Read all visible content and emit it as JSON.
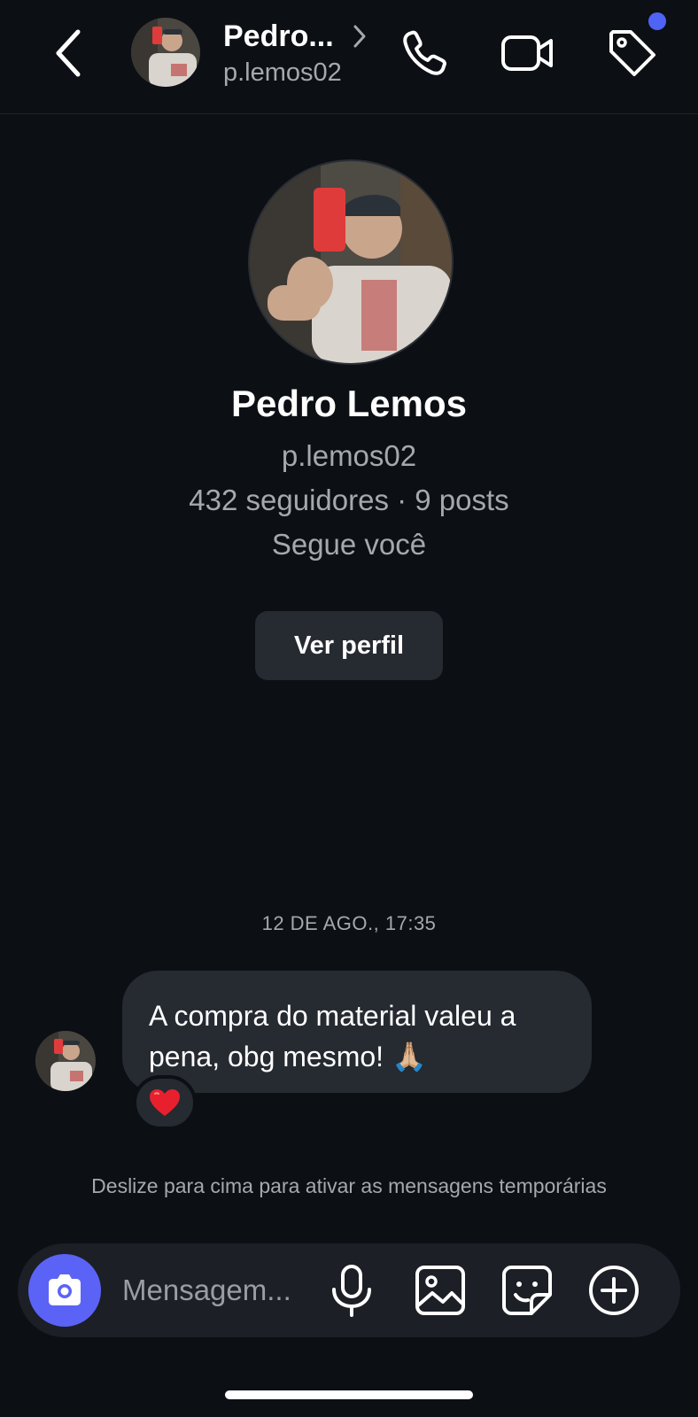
{
  "header": {
    "name": "Pedro...",
    "username": "p.lemos02",
    "icons": [
      "back-icon",
      "chevron-right-icon",
      "phone-icon",
      "video-icon",
      "tag-icon"
    ]
  },
  "profile": {
    "name": "Pedro Lemos",
    "username": "p.lemos02",
    "stats": "432 seguidores · 9 posts",
    "follows_you": "Segue você",
    "view_profile_label": "Ver perfil"
  },
  "conversation": {
    "timestamp": "12 DE AGO., 17:35",
    "messages": [
      {
        "sender": "Pedro Lemos",
        "text": "A compra do material valeu a pena, obg mesmo! 🙏🏼",
        "reaction": "❤️"
      }
    ],
    "hint": "Deslize para cima para ativar as mensagens temporárias"
  },
  "composer": {
    "placeholder": "Mensagem...",
    "icons": [
      "camera-icon",
      "microphone-icon",
      "gallery-icon",
      "sticker-icon",
      "plus-icon"
    ]
  },
  "colors": {
    "background": "#0c0f14",
    "bubble": "#262a31",
    "accent": "#5b63f6",
    "notification_dot": "#4f63f5",
    "secondary_text": "#a5a8ad"
  }
}
